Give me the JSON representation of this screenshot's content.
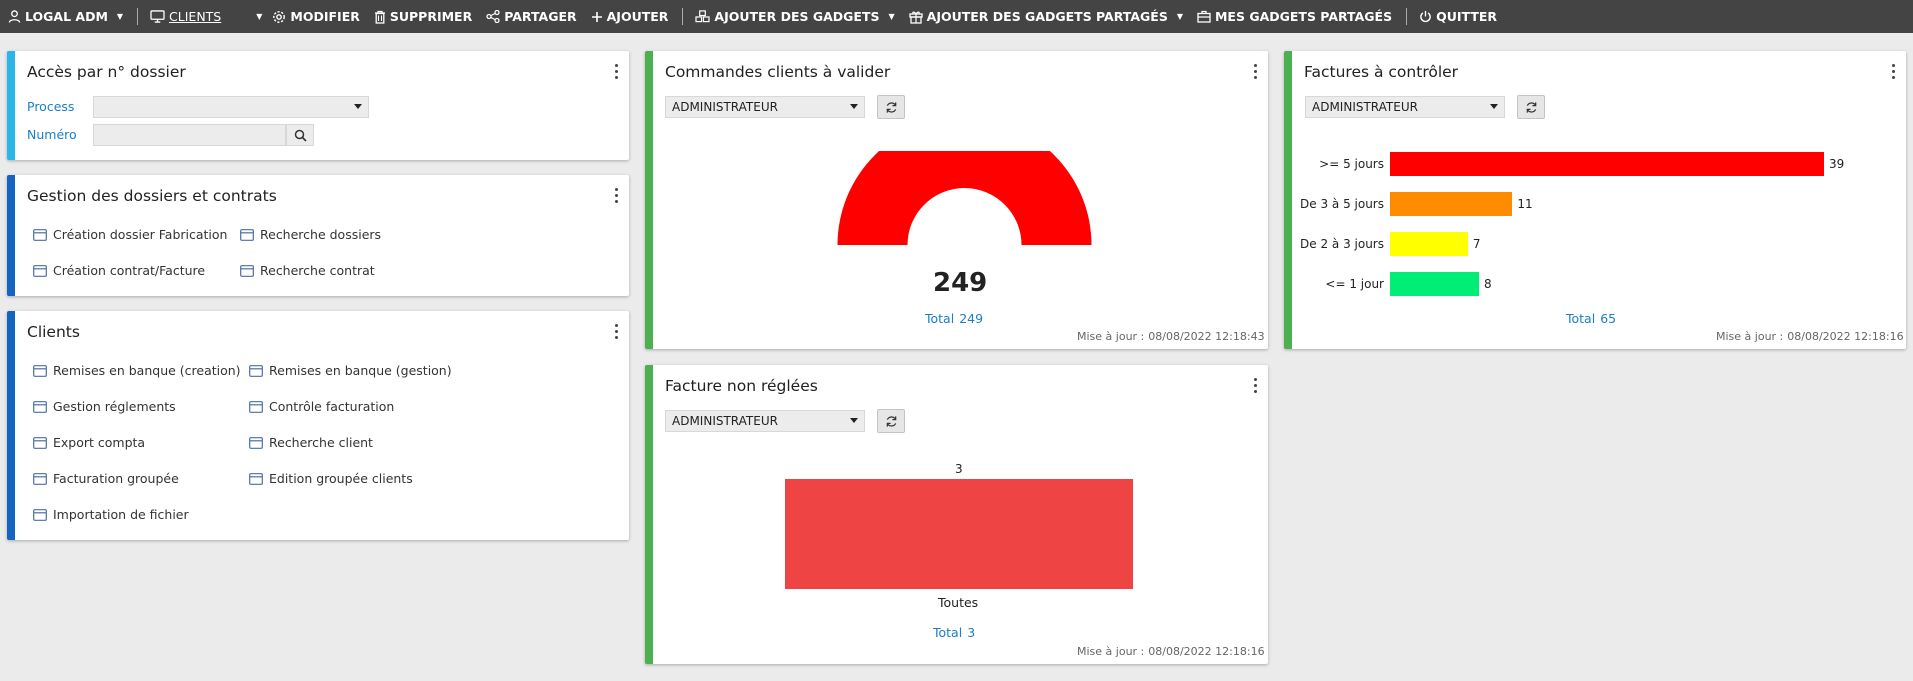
{
  "topbar": {
    "user": "LOGAL ADM",
    "clients": "CLIENTS",
    "modifier": "MODIFIER",
    "supprimer": "SUPPRIMER",
    "partager": "PARTAGER",
    "ajouter": "AJOUTER",
    "ajouter_gadgets": "AJOUTER DES GADGETS",
    "ajouter_gadgets_partages": "AJOUTER DES GADGETS PARTAGÉS",
    "mes_gadgets_partages": "MES GADGETS PARTAGÉS",
    "quitter": "QUITTER"
  },
  "colors": {
    "topbar_bg": "#444444",
    "accent_cyan": "#29b6e8",
    "accent_blue": "#1565c0",
    "accent_green": "#4caf50",
    "link_blue": "#1a7ec9",
    "gauge_red": "#ff0000",
    "bar_red": "#ff0000",
    "bar_orange": "#ff8c00",
    "bar_yellow": "#ffff00",
    "bar_green": "#00ee76",
    "vbar_red": "#ef4444"
  },
  "acces": {
    "title": "Accès par n° dossier",
    "process_label": "Process",
    "process_value": "",
    "numero_label": "Numéro",
    "numero_value": ""
  },
  "gestion": {
    "title": "Gestion des dossiers et contrats",
    "links": [
      "Création dossier Fabrication",
      "Recherche dossiers",
      "Création contrat/Facture",
      "Recherche contrat"
    ]
  },
  "clients": {
    "title": "Clients",
    "links": [
      "Remises en banque (creation)",
      "Remises en banque (gestion)",
      "Gestion réglements",
      "Contrôle facturation",
      "Export compta",
      "Recherche client",
      "Facturation groupée",
      "Edition groupée clients",
      "Importation de fichier"
    ]
  },
  "commandes": {
    "title": "Commandes clients à valider",
    "select": "ADMINISTRATEUR",
    "total_label": "Total",
    "total_value": "249",
    "update_label": "Mise à jour :",
    "update_value": "08/08/2022 12:18:43"
  },
  "factures_controler": {
    "title": "Factures à contrôler",
    "select": "ADMINISTRATEUR",
    "total_label": "Total",
    "total_value": "65",
    "update_label": "Mise à jour :",
    "update_value": "08/08/2022 12:18:16"
  },
  "facture_non_reglees": {
    "title": "Facture non réglées",
    "select": "ADMINISTRATEUR",
    "total_label": "Total",
    "total_value": "3",
    "update_label": "Mise à jour :",
    "update_value": "08/08/2022 12:18:16"
  },
  "chart_data": [
    {
      "type": "pie",
      "variant": "gauge",
      "values": [
        249
      ],
      "labels": [
        "249"
      ],
      "colors": [
        "#ff0000"
      ]
    },
    {
      "type": "bar",
      "orientation": "horizontal",
      "categories": [
        ">= 5 jours",
        "De 3 à 5 jours",
        "De 2 à 3 jours",
        "<= 1 jour"
      ],
      "values": [
        39,
        11,
        7,
        8
      ],
      "colors": [
        "#ff0000",
        "#ff8c00",
        "#ffff00",
        "#00ee76"
      ],
      "xlim": [
        0,
        39
      ]
    },
    {
      "type": "bar",
      "categories": [
        "Toutes"
      ],
      "values": [
        3
      ],
      "colors": [
        "#ef4444"
      ],
      "ylim": [
        0,
        3
      ]
    }
  ]
}
